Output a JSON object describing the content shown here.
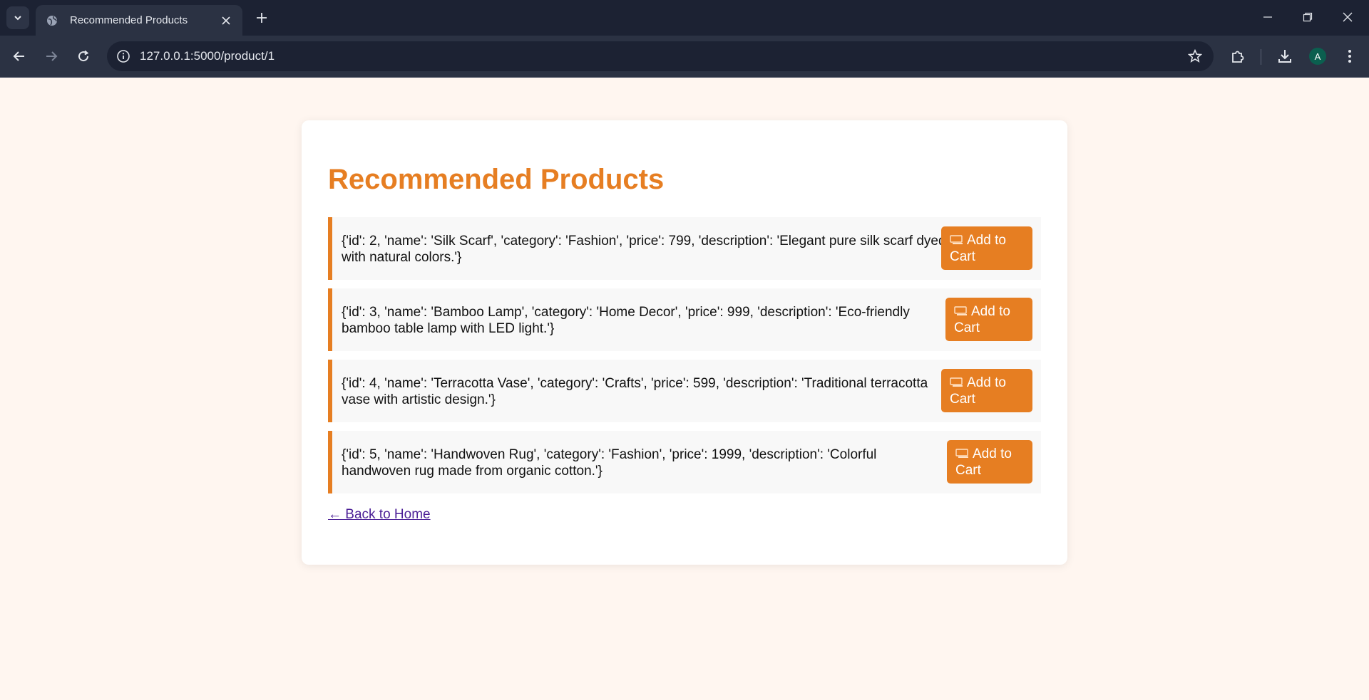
{
  "browser": {
    "tab_title": "Recommended Products",
    "url": "127.0.0.1:5000/product/1",
    "avatar_letter": "A"
  },
  "page": {
    "title": "Recommended Products",
    "back_link": "← Back to Home"
  },
  "products": [
    {
      "text": "{'id': 2, 'name': 'Silk Scarf', 'category': 'Fashion', 'price': 799, 'description': 'Elegant pure silk scarf dyed with natural colors.'}",
      "button": "Add to Cart"
    },
    {
      "text": "{'id': 3, 'name': 'Bamboo Lamp', 'category': 'Home Decor', 'price': 999, 'description': 'Eco-friendly bamboo table lamp with LED light.'}",
      "button": "Add to Cart"
    },
    {
      "text": "{'id': 4, 'name': 'Terracotta Vase', 'category': 'Crafts', 'price': 599, 'description': 'Traditional terracotta vase with artistic design.'}",
      "button": "Add to Cart"
    },
    {
      "text": "{'id': 5, 'name': 'Handwoven Rug', 'category': 'Fashion', 'price': 1999, 'description': 'Colorful handwoven rug made from organic cotton.'}",
      "button": "Add to Cart"
    }
  ],
  "colors": {
    "accent": "#e67e22",
    "page_bg": "#fff6f0",
    "link": "#4b1f96"
  }
}
